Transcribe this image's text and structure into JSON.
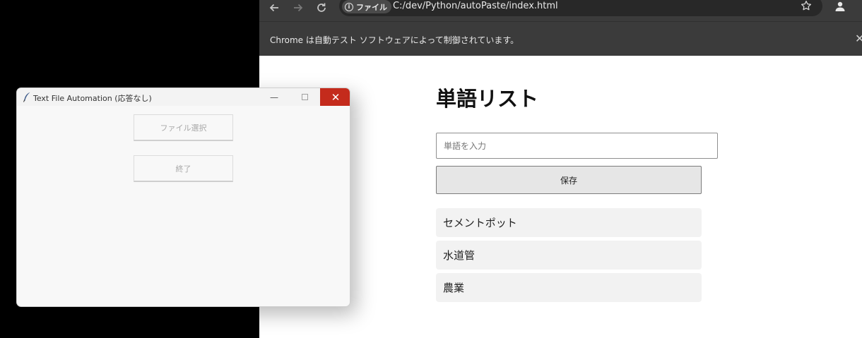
{
  "chrome": {
    "address": {
      "site_chip_label": "ファイル",
      "url": "C:/dev/Python/autoPaste/index.html"
    },
    "infobar": {
      "message": "Chrome は自動テスト ソフトウェアによって制御されています。",
      "close_glyph": "✕"
    },
    "icons": {
      "info": "i"
    }
  },
  "page": {
    "heading": "単語リスト",
    "input_placeholder": "単語を入力",
    "save_label": "保存",
    "words": [
      "セメントポット",
      "水道管",
      "農業"
    ]
  },
  "tk_window": {
    "title": "Text File Automation (応答なし)",
    "minimize_glyph": "—",
    "close_glyph": "✕",
    "file_button_label": "ファイル選択",
    "exit_button_label": "終了"
  }
}
